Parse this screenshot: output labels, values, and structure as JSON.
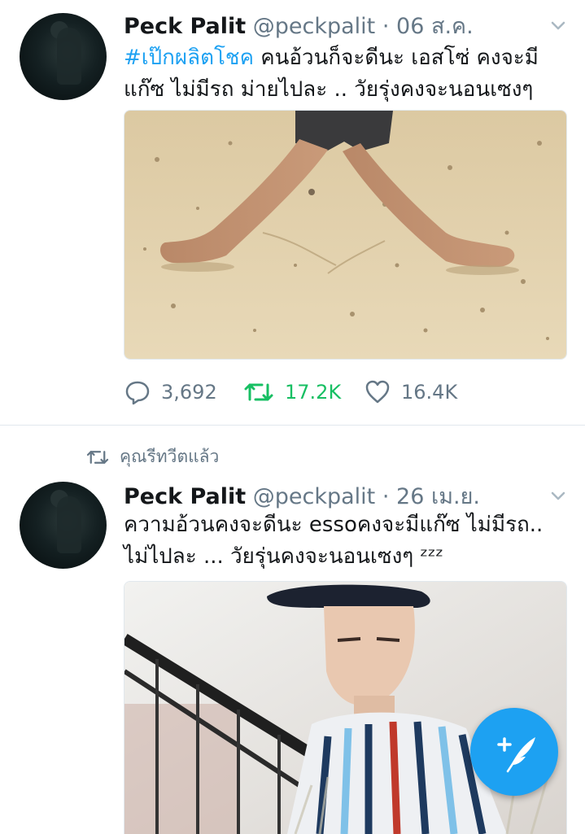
{
  "tweets": [
    {
      "name": "Peck Palit",
      "handle": "@peckpalit",
      "date": "· 06 ส.ค.",
      "hashtag": "#เป๊กผลิตโชค",
      "text_rest": " คนอ้วนก็จะดีนะ เอสโซ่ คงจะมีแก๊ซ ไม่มีรถ ม่ายไปละ .. วัยรุ่งคงจะนอนเซงๆ",
      "media": "beach-legs-photo",
      "stats": {
        "replies": "3,692",
        "retweets": "17.2K",
        "likes": "16.4K"
      }
    },
    {
      "retweeted_label": "คุณรีทวีตแล้ว",
      "name": "Peck Palit",
      "handle": "@peckpalit",
      "date": "· 26 เม.ย.",
      "text": "ความอ้วนคงจะดีนะ essoคงจะมีแก๊ซ ไม่มีรถ.. ไม่ไปละ ... วัยรุ่นคงจะนอนเซงๆ ᶻᶻᶻ",
      "media": "portrait-striped-shirt-photo"
    }
  ],
  "icons": {
    "reply": "speech-bubble-icon",
    "retweet": "retweet-icon",
    "like": "heart-icon",
    "menu": "chevron-down-icon",
    "compose": "feather-plus-icon"
  },
  "colors": {
    "accent": "#1da1f2",
    "retweet_active": "#17bf63",
    "muted": "#657786"
  }
}
